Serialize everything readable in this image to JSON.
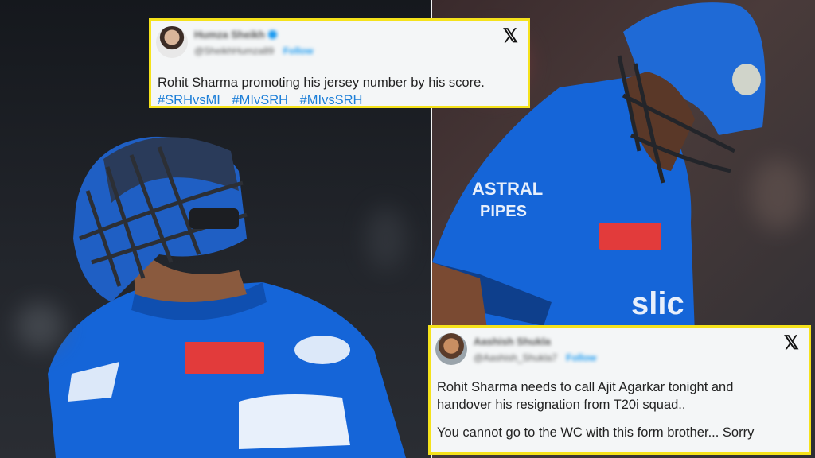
{
  "tweets": [
    {
      "author_name": "Humza Sheikh",
      "handle": "@SheikhHumza89",
      "follow_label": "Follow",
      "x_icon": "x-logo-icon",
      "text": "Rohit Sharma promoting his jersey number by his score.",
      "hashtags": [
        "#SRHvsMI",
        "#MIvSRH",
        "#MIvsSRH"
      ]
    },
    {
      "author_name": "Aashish Shukla",
      "handle": "@Aashish_Shukla7",
      "follow_label": "Follow",
      "x_icon": "x-logo-icon",
      "text_line1": "Rohit Sharma needs to call Ajit Agarkar tonight and",
      "text_line2": "handover his resignation from T20i squad..",
      "text_line3": "You cannot go to the WC with this form brother... Sorry"
    }
  ],
  "colors": {
    "card_border": "#f5e21b",
    "hashtag": "#1d7fd8",
    "jersey": "#1565d8"
  }
}
